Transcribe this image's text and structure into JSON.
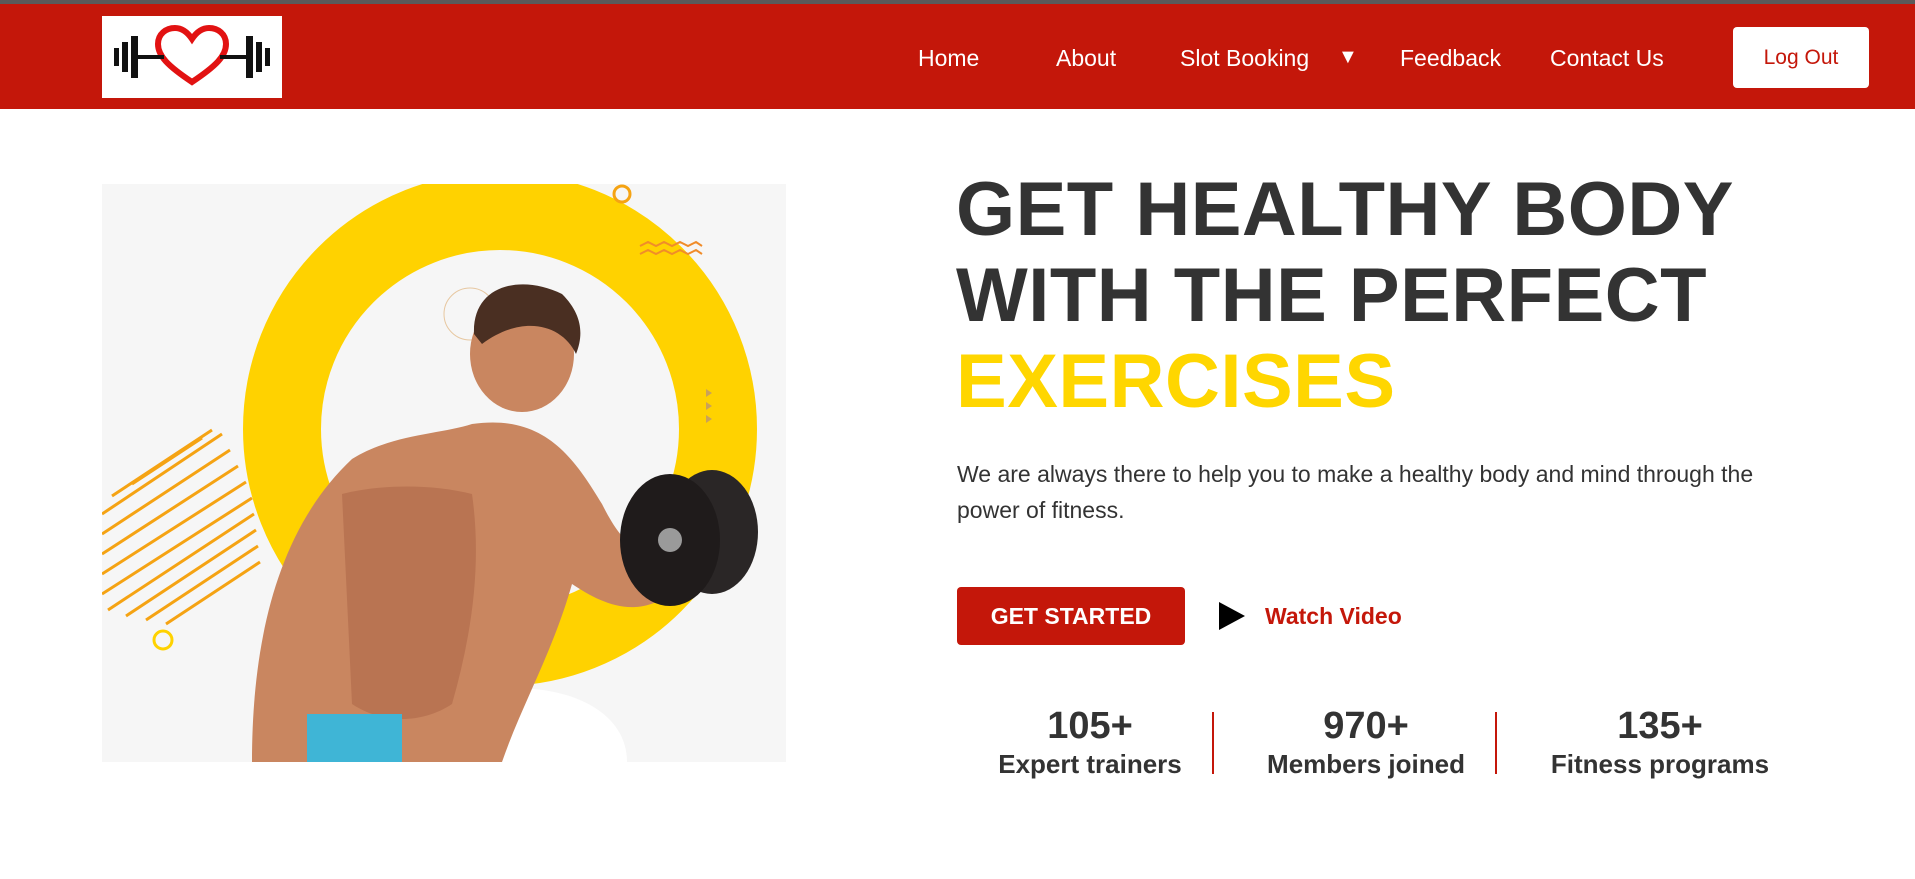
{
  "nav": {
    "links": [
      "Home",
      "About",
      "Slot Booking",
      "Feedback",
      "Contact Us"
    ],
    "dropdown_caret": "▼",
    "logout_label": "Log Out",
    "logo_icon": "heartbeat-dumbbell-icon"
  },
  "hero": {
    "headline_line1": "GET HEALTHY BODY",
    "headline_line2": "WITH THE PERFECT",
    "headline_accent": "EXERCISES",
    "description": "We are always there to help you to make a healthy body and mind through the power of fitness.",
    "cta_label": "GET STARTED",
    "video_label": "Watch Video",
    "image_icon": "bodybuilder-with-dumbbell-image"
  },
  "stats": [
    {
      "value": "105+",
      "label": "Expert trainers"
    },
    {
      "value": "970+",
      "label": "Members joined"
    },
    {
      "value": "135+",
      "label": "Fitness programs"
    }
  ],
  "colors": {
    "brand_red": "#c4170a",
    "accent_yellow": "#ffd600",
    "text_dark": "#333333"
  }
}
